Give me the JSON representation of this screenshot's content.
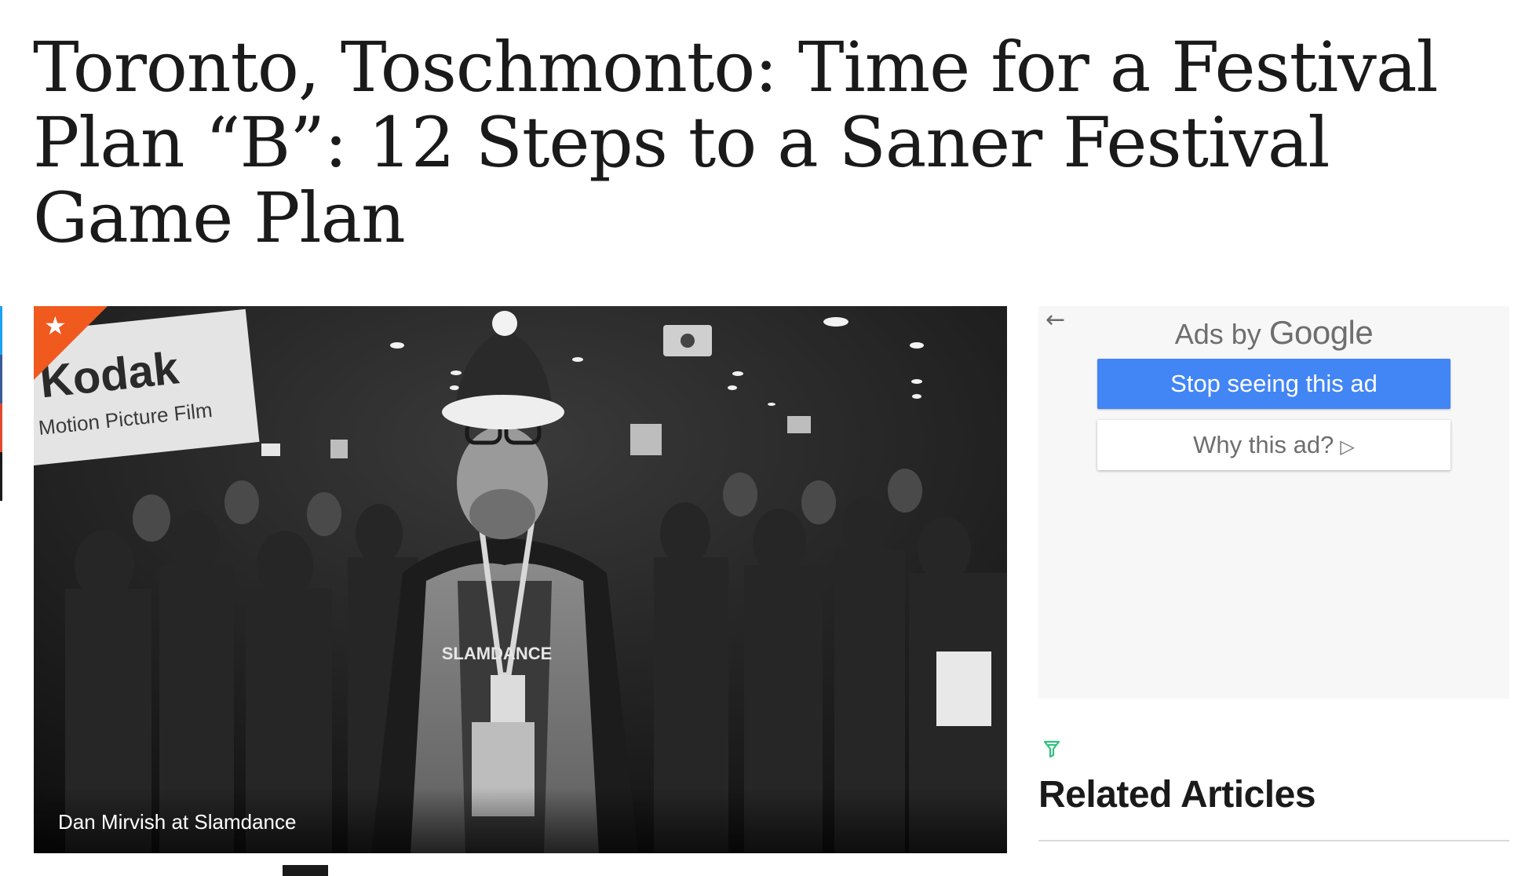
{
  "article": {
    "title": "Toronto, Toschmonto: Time for a Festival Plan “B”: 12 Steps to a Saner Festival Game Plan",
    "featured_icon": "star-icon",
    "hero_image": {
      "alt": "Dan Mirvish at Slamdance",
      "caption": "Dan Mirvish at Slamdance",
      "banner_text_line1": "Kodak",
      "banner_text_line2": "Motion Picture Film",
      "tee_text": "SLAMDANCE"
    }
  },
  "share_bar": {
    "colors": [
      "#1da1f2",
      "#3b5998",
      "#e04a2f",
      "#1a1a1a"
    ]
  },
  "ad": {
    "back_icon": "arrow-left-icon",
    "ads_by": "Ads by",
    "google": "Google",
    "stop_label": "Stop seeing this ad",
    "why_label": "Why this ad?",
    "why_icon": "play-outline-icon"
  },
  "sidebar": {
    "sponsor_icon": "funnel-icon",
    "related_title": "Related Articles"
  },
  "colors": {
    "badge": "#f05a1e",
    "ad_button": "#4285f4",
    "ad_background": "#f7f7f7"
  }
}
